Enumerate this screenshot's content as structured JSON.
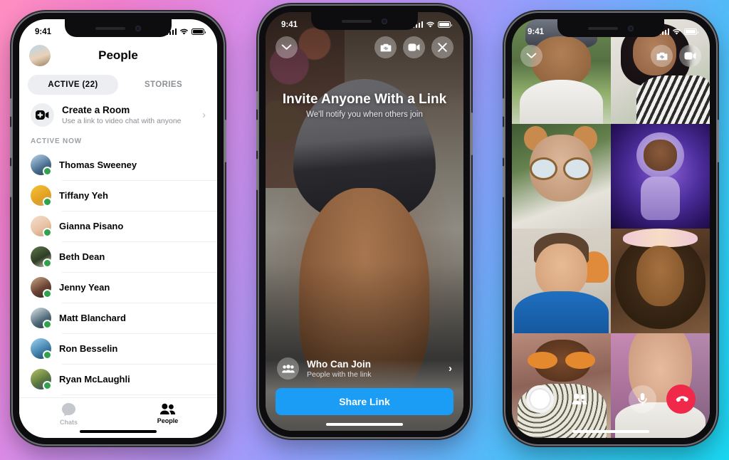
{
  "background": {
    "gradient_from": "#ff8fc0",
    "gradient_mid": "#9b9bfb",
    "gradient_to": "#1ad6f0"
  },
  "phone1": {
    "name": "messenger-people-screen",
    "status_bar": {
      "time": "9:41",
      "signal_icon": "cellular-bars-icon",
      "wifi_icon": "wifi-icon",
      "battery_icon": "battery-icon"
    },
    "header": {
      "title": "People",
      "avatar": "user-avatar"
    },
    "tabs": [
      {
        "label": "ACTIVE (22)",
        "active": true
      },
      {
        "label": "STORIES",
        "active": false
      }
    ],
    "create_room": {
      "title": "Create a Room",
      "subtitle": "Use a link to video chat with anyone",
      "icon": "video-plus-icon",
      "chevron": "chevron-right-icon"
    },
    "section_label": "ACTIVE NOW",
    "contacts": [
      {
        "name": "Thomas Sweeney",
        "online": true
      },
      {
        "name": "Tiffany Yeh",
        "online": true
      },
      {
        "name": "Gianna Pisano",
        "online": true
      },
      {
        "name": "Beth Dean",
        "online": true
      },
      {
        "name": "Jenny Yean",
        "online": true
      },
      {
        "name": "Matt Blanchard",
        "online": true
      },
      {
        "name": "Ron Besselin",
        "online": true
      },
      {
        "name": "Ryan McLaughli",
        "online": true
      }
    ],
    "tabbar": [
      {
        "label": "Chats",
        "icon": "chat-bubble-icon",
        "active": false
      },
      {
        "label": "People",
        "icon": "people-icon",
        "active": true
      }
    ]
  },
  "phone2": {
    "name": "messenger-rooms-invite-screen",
    "status_bar": {
      "time": "9:41",
      "signal_icon": "cellular-bars-icon",
      "wifi_icon": "wifi-icon",
      "battery_icon": "battery-icon"
    },
    "top_controls": {
      "minimize": "chevron-down-icon",
      "flip_camera": "camera-flip-icon",
      "video": "video-camera-icon",
      "close": "close-x-icon"
    },
    "headline": "Invite Anyone With a Link",
    "subhead": "We'll notify you when others join",
    "who_can_join": {
      "title": "Who Can Join",
      "subtitle": "People with the link",
      "icon": "group-people-icon",
      "chevron": "chevron-right-icon"
    },
    "share_button": {
      "label": "Share Link",
      "color": "#1b9df5"
    }
  },
  "phone3": {
    "name": "messenger-rooms-group-call-screen",
    "status_bar": {
      "time": "9:41",
      "signal_icon": "cellular-bars-icon",
      "wifi_icon": "wifi-icon",
      "battery_icon": "battery-icon"
    },
    "top_controls": {
      "minimize": "chevron-down-icon",
      "flip_camera": "camera-flip-icon",
      "video": "video-camera-icon"
    },
    "participants": [
      {
        "position": "row1-left",
        "description": "man-in-backwards-cap-outdoors"
      },
      {
        "position": "row1-right",
        "description": "woman-with-striped-top-indoors"
      },
      {
        "position": "row2-left",
        "description": "man-with-bear-ears-and-glasses-filter"
      },
      {
        "position": "row2-right",
        "description": "astronaut-avatar-filter"
      },
      {
        "position": "row3-left",
        "description": "man-in-blue-hoodie"
      },
      {
        "position": "row3-right",
        "description": "woman-with-flower-crown-filter"
      },
      {
        "position": "row4-left",
        "description": "woman-with-butterfly-glasses-filter"
      },
      {
        "position": "row4-right",
        "description": "woman-with-pink-hair-and-earbuds"
      }
    ],
    "call_controls": [
      {
        "name": "capture-button",
        "icon": "shutter-circle-icon"
      },
      {
        "name": "add-people-button",
        "icon": "people-icon"
      },
      {
        "name": "mute-button",
        "icon": "microphone-icon"
      },
      {
        "name": "end-call-button",
        "icon": "phone-hangup-icon",
        "color": "#f02849"
      }
    ]
  }
}
